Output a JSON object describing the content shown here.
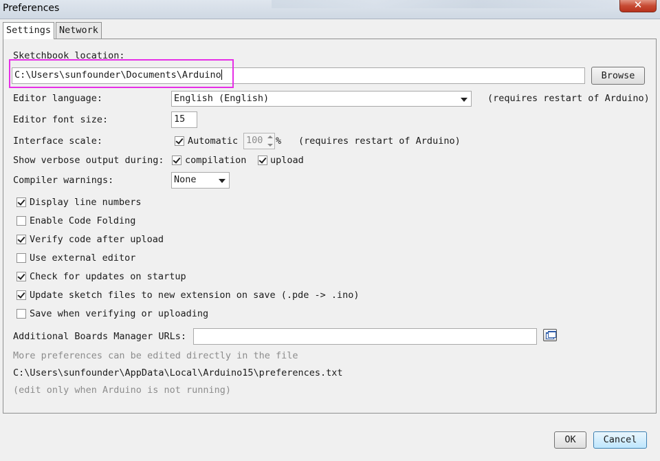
{
  "window": {
    "title": "Preferences",
    "close_label": "✕"
  },
  "tabs": [
    {
      "label": "Settings",
      "active": true
    },
    {
      "label": "Network",
      "active": false
    }
  ],
  "sketchbook": {
    "label": "Sketchbook location:",
    "value": "C:\\Users\\sunfounder\\Documents\\Arduino",
    "browse_label": "Browse"
  },
  "editor_language": {
    "label": "Editor language:",
    "value": "English (English)",
    "note": "(requires restart of Arduino)"
  },
  "font_size": {
    "label": "Editor font size:",
    "value": "15"
  },
  "interface_scale": {
    "label": "Interface scale:",
    "automatic_label": "Automatic",
    "automatic_checked": true,
    "value": "100",
    "unit": "%",
    "note": "(requires restart of Arduino)"
  },
  "verbose": {
    "label": "Show verbose output during:",
    "compilation_label": "compilation",
    "compilation_checked": true,
    "upload_label": "upload",
    "upload_checked": true
  },
  "compiler_warnings": {
    "label": "Compiler warnings:",
    "value": "None"
  },
  "options": [
    {
      "label": "Display line numbers",
      "checked": true
    },
    {
      "label": "Enable Code Folding",
      "checked": false
    },
    {
      "label": "Verify code after upload",
      "checked": true
    },
    {
      "label": "Use external editor",
      "checked": false
    },
    {
      "label": "Check for updates on startup",
      "checked": true
    },
    {
      "label": "Update sketch files to new extension on save (.pde -> .ino)",
      "checked": true
    },
    {
      "label": "Save when verifying or uploading",
      "checked": false
    }
  ],
  "boards_manager": {
    "label": "Additional Boards Manager URLs:",
    "value": ""
  },
  "footer_info": {
    "more_prefs": "More preferences can be edited directly in the file",
    "path": "C:\\Users\\sunfounder\\AppData\\Local\\Arduino15\\preferences.txt",
    "edit_note": "(edit only when Arduino is not running)"
  },
  "buttons": {
    "ok": "OK",
    "cancel": "Cancel"
  },
  "colors": {
    "highlight": "#e62ee6",
    "close": "#c74b34"
  },
  "icons": {
    "url_list_editor": "window-stack-icon",
    "close": "close-icon"
  }
}
